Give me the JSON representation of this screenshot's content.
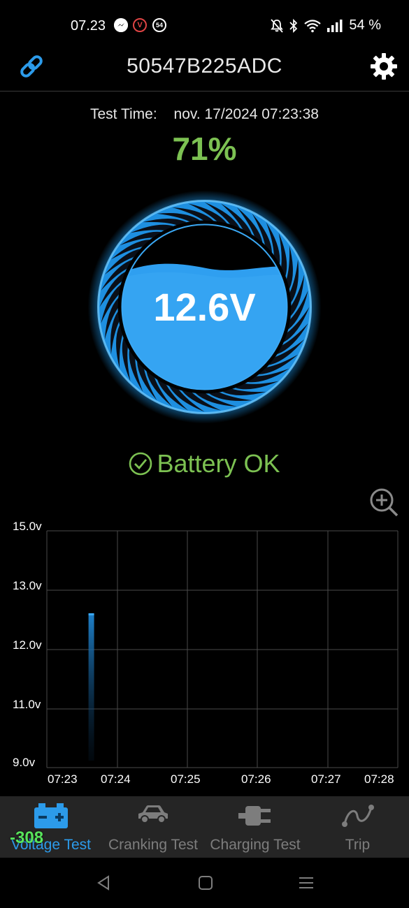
{
  "status_bar": {
    "time": "07.23",
    "notifications": [
      "messenger-icon",
      "v-icon",
      "54"
    ],
    "battery": "54 %"
  },
  "header": {
    "device_name": "50547B225ADC",
    "icons": [
      "link-icon",
      "gear-icon"
    ]
  },
  "test": {
    "time_label": "Test Time:",
    "time_value": "nov. 17/2024 07:23:38",
    "percent": "71%",
    "voltage": "12.6V",
    "status": "Battery OK",
    "colors": {
      "ok_green": "#7cc152",
      "accent_blue": "#2c9bea"
    }
  },
  "chart_data": {
    "type": "bar",
    "y_tick_labels": [
      "15.0v",
      "13.0v",
      "12.0v",
      "11.0v",
      "9.0v"
    ],
    "x_tick_labels": [
      "07:23",
      "07:24",
      "07:25",
      "07:26",
      "07:27",
      "07:28"
    ],
    "ylim": [
      9.0,
      15.0
    ],
    "grid": true,
    "series": [
      {
        "x": [
          "07:23:38"
        ],
        "values": [
          12.6
        ]
      }
    ]
  },
  "tabs": [
    {
      "label": "Voltage Test",
      "icon": "battery-icon",
      "active": true
    },
    {
      "label": "Cranking Test",
      "icon": "car-icon",
      "active": false
    },
    {
      "label": "Charging Test",
      "icon": "plug-icon",
      "active": false
    },
    {
      "label": "Trip",
      "icon": "route-icon",
      "active": false
    }
  ],
  "tab_badge": "-308",
  "nav": [
    "back-icon",
    "home-icon",
    "recents-icon"
  ]
}
